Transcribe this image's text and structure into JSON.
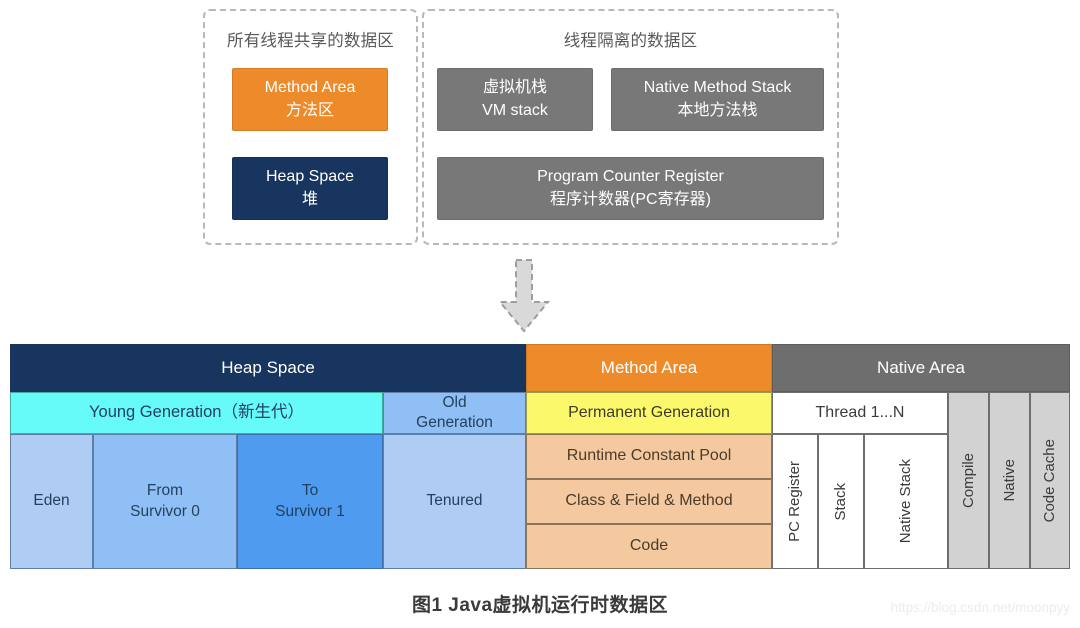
{
  "top": {
    "shared_group": {
      "title": "所有线程共享的数据区",
      "blocks": [
        {
          "name": "method-area",
          "line1": "Method Area",
          "line2": "方法区",
          "color": "#ED8B2B"
        },
        {
          "name": "heap-space",
          "line1": "Heap Space",
          "line2": "堆",
          "color": "#17355E"
        }
      ]
    },
    "isolated_group": {
      "title": "线程隔离的数据区",
      "blocks": [
        {
          "name": "vm-stack",
          "line1": "虚拟机栈",
          "line2": "VM stack",
          "color": "#787878"
        },
        {
          "name": "native-method-stack",
          "line1": "Native Method Stack",
          "line2": "本地方法栈",
          "color": "#787878"
        },
        {
          "name": "pc-register",
          "line1": "Program Counter Register",
          "line2": "程序计数器(PC寄存器)",
          "color": "#787878"
        }
      ]
    }
  },
  "connector": {
    "icon": "down-arrow-icon",
    "color": "#D9D9D9"
  },
  "table": {
    "headers": {
      "heap_space": "Heap Space",
      "method_area": "Method Area",
      "native_area": "Native Area"
    },
    "row2": {
      "young_generation": "Young Generation（新生代）",
      "old_generation": "Old\nGeneration",
      "old_generation_l1": "Old",
      "old_generation_l2": "Generation",
      "permanent_generation": "Permanent Generation",
      "thread": "Thread 1...N"
    },
    "row3": {
      "eden": "Eden",
      "from_survivor_l1": "From",
      "from_survivor_l2": "Survivor 0",
      "to_survivor_l1": "To",
      "to_survivor_l2": "Survivor 1",
      "tenured": "Tenured",
      "runtime_constant_pool": "Runtime Constant Pool",
      "class_field_method": "Class & Field & Method",
      "code": "Code",
      "pc_register": "PC Register",
      "stack": "Stack",
      "native_stack": "Native Stack",
      "compile": "Compile",
      "native": "Native",
      "code_cache": "Code Cache"
    },
    "colors": {
      "heap_header": "#17355E",
      "method_header": "#ED8B2B",
      "native_header": "#6E6E6E",
      "young_gen": "#66FBF9",
      "old_gen": "#90BFF5",
      "eden": "#AFCDF4",
      "from_survivor": "#90BFF5",
      "to_survivor": "#4E9BEF",
      "tenured": "#AFCDF4",
      "permanent_gen": "#FBF96B",
      "method_sub": "#F4C9A0",
      "thread_cells": "#FFFFFF",
      "native_cols": "#D2D2D2"
    }
  },
  "caption": "图1  Java虚拟机运行时数据区",
  "watermark": "https://blog.csdn.net/moonpyy"
}
